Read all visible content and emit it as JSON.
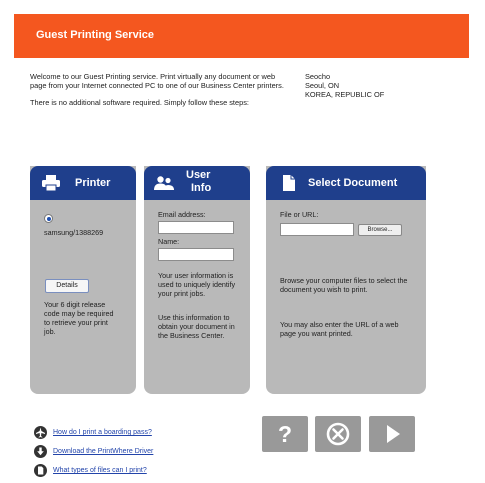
{
  "header": {
    "title": "Guest Printing Service"
  },
  "intro": {
    "welcome": "Welcome to our Guest Printing service. Print virtually any document or web page from your Internet connected PC to one of our Business Center printers.",
    "no_software": "There is no additional software required. Simply follow these steps:"
  },
  "location": {
    "line1": "Seocho",
    "line2": "Seoul, ON",
    "line3": "KOREA, REPUBLIC OF"
  },
  "printer_panel": {
    "title": "Printer",
    "printer_name": "samsung/1388269",
    "details_label": "Details",
    "release_note": "Your 6 digit release code may be required to retrieve your print job."
  },
  "user_panel": {
    "title_line1": "User",
    "title_line2": "Info",
    "email_label": "Email address:",
    "email_value": "",
    "name_label": "Name:",
    "name_value": "",
    "info_text1": "Your user information is used to uniquely identify your print jobs.",
    "info_text2": "Use this information to obtain your document in the Business Center."
  },
  "document_panel": {
    "title": "Select Document",
    "file_label": "File or URL:",
    "file_value": "",
    "browse_label": "Browse...",
    "browse_text": "Browse your computer files to select the document you wish to print.",
    "url_text": "You may also enter the URL of a web page you want printed."
  },
  "links": [
    {
      "label": "How do I print a boarding pass?",
      "icon": "airplane-icon"
    },
    {
      "label": "Download the PrintWhere Driver",
      "icon": "download-icon"
    },
    {
      "label": "What types of files can I print?",
      "icon": "document-icon"
    }
  ],
  "actions": {
    "help_label": "?",
    "cancel_icon": "cancel-icon",
    "next_icon": "play-icon"
  },
  "colors": {
    "header_orange": "#f4571f",
    "panel_head_blue": "#1f3f8c",
    "panel_gray": "#b9b9b9",
    "button_gray": "#999999",
    "link_blue": "#2244aa"
  }
}
